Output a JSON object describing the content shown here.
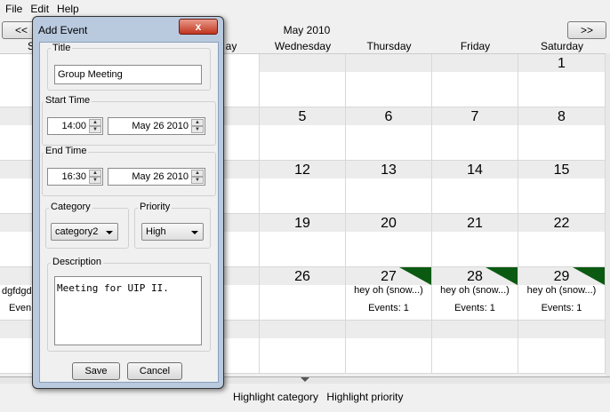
{
  "menu": {
    "items": [
      "File",
      "Edit",
      "Help"
    ]
  },
  "nav": {
    "prev_label": "<<",
    "next_label": ">>",
    "month": "May 2010"
  },
  "day_headers": [
    "S",
    "ay",
    "Wednesday",
    "Thursday",
    "Friday",
    "Saturday"
  ],
  "weeks": [
    {
      "days": [
        {
          "num": ""
        },
        {
          "num": ""
        },
        {
          "num": ""
        },
        {
          "num": "1"
        }
      ]
    },
    {
      "days": [
        {
          "num": "5"
        },
        {
          "num": "6"
        },
        {
          "num": "7"
        },
        {
          "num": "8"
        }
      ]
    },
    {
      "days": [
        {
          "num": "12"
        },
        {
          "num": "13"
        },
        {
          "num": "14"
        },
        {
          "num": "15"
        }
      ]
    },
    {
      "days": [
        {
          "num": "19"
        },
        {
          "num": "20"
        },
        {
          "num": "21"
        },
        {
          "num": "22"
        }
      ]
    },
    {
      "days": [
        {
          "num": "26",
          "event": "",
          "count": ""
        },
        {
          "num": "27",
          "event": "hey oh (snow...)",
          "count": "Events: 1"
        },
        {
          "num": "28",
          "event": "hey oh (snow...)",
          "count": "Events: 1"
        },
        {
          "num": "29",
          "event": "hey oh (snow...)",
          "count": "Events: 1"
        }
      ]
    },
    {
      "days": [
        {
          "num": ""
        },
        {
          "num": ""
        },
        {
          "num": ""
        },
        {
          "num": ""
        }
      ]
    }
  ],
  "left_partial": {
    "event": "dgfdgd",
    "count": "Even"
  },
  "bottom": {
    "highlight_category": "Highlight category",
    "highlight_priority": "Highlight priority"
  },
  "dialog": {
    "title": "Add Event",
    "close_label": "x",
    "title_group": "Title",
    "title_value": "Group Meeting",
    "start_group": "Start Time",
    "start_time": "14:00",
    "start_date": "May 26 2010",
    "end_group": "End Time",
    "end_time": "16:30",
    "end_date": "May 26 2010",
    "category_group": "Category",
    "category_value": "category2",
    "priority_group": "Priority",
    "priority_value": "High",
    "description_group": "Description",
    "description_value": "Meeting for UIP II.",
    "save_label": "Save",
    "cancel_label": "Cancel"
  },
  "colors": {
    "event_marker": "#0b5a12",
    "dialog_frame": "#b9c9de",
    "close_button": "#c0341f"
  }
}
